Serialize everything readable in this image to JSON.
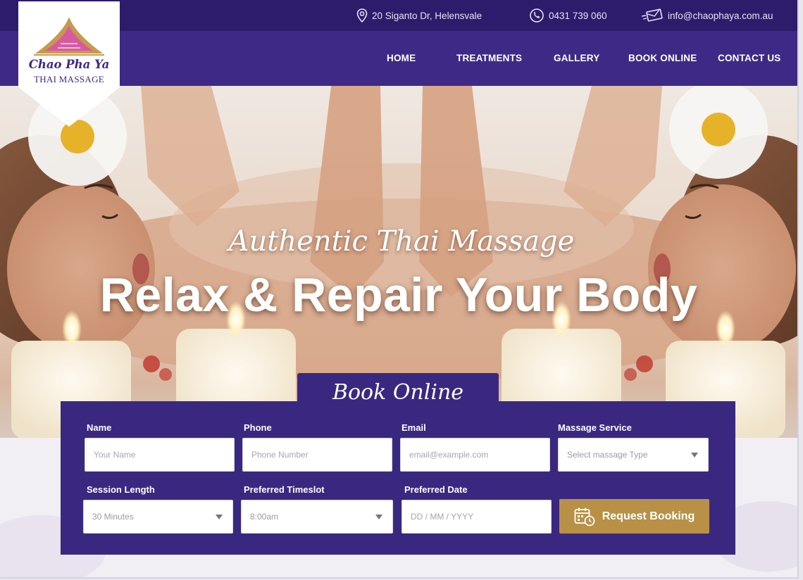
{
  "topbar": {
    "address": "20 Siganto Dr, Helensvale",
    "phone": "0431 739 060",
    "email": "info@chaophaya.com.au"
  },
  "logo": {
    "name": "Chao Pha Ya",
    "subtitle": "THAI MASSAGE"
  },
  "nav": {
    "items": [
      {
        "label": "HOME"
      },
      {
        "label": "TREATMENTS"
      },
      {
        "label": "GALLERY"
      },
      {
        "label": "BOOK ONLINE"
      },
      {
        "label": "CONTACT US"
      }
    ]
  },
  "hero": {
    "script_title": "Authentic Thai Massage",
    "headline": "Relax & Repair Your Body"
  },
  "booking": {
    "title": "Book Online",
    "fields": {
      "name": {
        "label": "Name",
        "placeholder": "Your Name"
      },
      "phone": {
        "label": "Phone",
        "placeholder": "Phone Number"
      },
      "email": {
        "label": "Email",
        "placeholder": "email@example.com"
      },
      "service": {
        "label": "Massage Service",
        "value": "Select massage Type"
      },
      "session": {
        "label": "Session Length",
        "value": "30 Minutes"
      },
      "timeslot": {
        "label": "Preferred Timeslot",
        "value": "8:00am"
      },
      "date": {
        "label": "Preferred Date",
        "placeholder": "DD / MM / YYYY"
      }
    },
    "submit_label": "Request Booking"
  },
  "colors": {
    "topbar": "#2d1c6b",
    "navbar": "#3e2a86",
    "panel": "#3a2880",
    "button": "#b89147"
  }
}
